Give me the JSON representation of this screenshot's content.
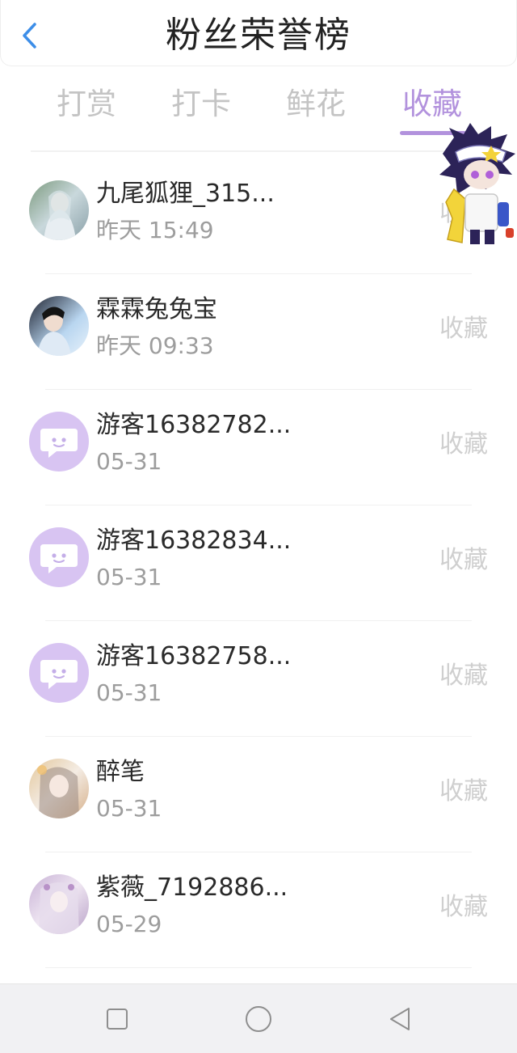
{
  "header": {
    "title": "粉丝荣誉榜"
  },
  "tabs": [
    {
      "label": "打赏",
      "active": false
    },
    {
      "label": "打卡",
      "active": false
    },
    {
      "label": "鲜花",
      "active": false
    },
    {
      "label": "收藏",
      "active": true
    }
  ],
  "colors": {
    "accent": "#b292dd",
    "guest_avatar": "#d8c4f2",
    "tab_inactive": "#c4c4c4"
  },
  "fans": [
    {
      "name": "九尾狐狸_315...",
      "time": "昨天 15:49",
      "action": "收藏",
      "avatar": "photo"
    },
    {
      "name": "霖霖兔兔宝",
      "time": "昨天 09:33",
      "action": "收藏",
      "avatar": "photo"
    },
    {
      "name": "游客16382782...",
      "time": "05-31",
      "action": "收藏",
      "avatar": "guest"
    },
    {
      "name": "游客16382834...",
      "time": "05-31",
      "action": "收藏",
      "avatar": "guest"
    },
    {
      "name": "游客16382758...",
      "time": "05-31",
      "action": "收藏",
      "avatar": "guest"
    },
    {
      "name": "醉笔",
      "time": "05-31",
      "action": "收藏",
      "avatar": "photo"
    },
    {
      "name": "紫薇_7192886...",
      "time": "05-29",
      "action": "收藏",
      "avatar": "photo"
    }
  ]
}
